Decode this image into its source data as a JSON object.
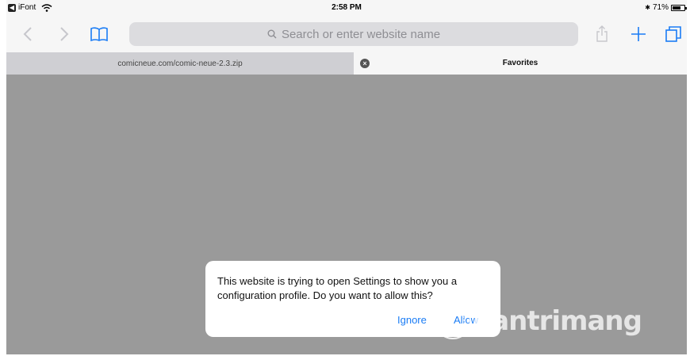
{
  "status_bar": {
    "carrier": "iFont",
    "time": "2:58 PM",
    "battery": "71%",
    "bluetooth_symbol": "✱"
  },
  "toolbar": {
    "search_placeholder": "Search or enter website name",
    "icons": [
      "back-icon",
      "forward-icon",
      "bookmarks-icon",
      "search-icon",
      "share-icon",
      "plus-icon",
      "tabs-icon"
    ]
  },
  "tabs": [
    {
      "label": "comicneue.com/comic-neue-2.3.zip",
      "active": false
    },
    {
      "label": "Favorites",
      "active": true
    }
  ],
  "dialog": {
    "message": "This website is trying to open Settings to show you a configuration profile. Do you want to allow this?",
    "ignore_label": "Ignore",
    "allow_label": "Allow"
  },
  "watermark": {
    "text": "uantrimang"
  },
  "colors": {
    "content_bg": "#9a9a9a",
    "bar_bg": "#f6f6f6",
    "accent": "#1a7cf5",
    "icon_gray": "#c7c7cc"
  }
}
